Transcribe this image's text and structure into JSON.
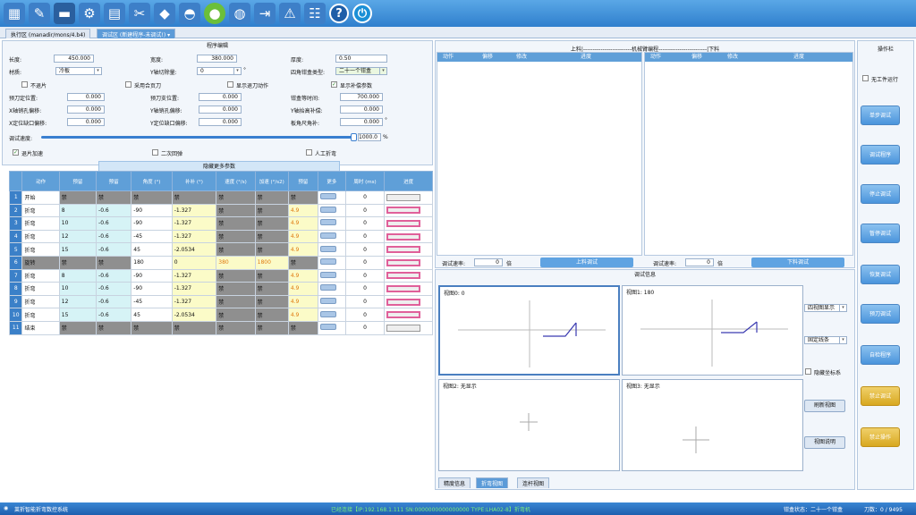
{
  "toolbar": {
    "icons": [
      "edit-window-icon",
      "new-document-icon",
      "monitor-icon",
      "gear-icon",
      "toolbox-icon",
      "tools-icon",
      "box-icon",
      "dome-icon",
      "circle-check-icon",
      "globe-icon",
      "logout-icon",
      "warning-icon",
      "network-icon",
      "help-icon",
      "power-icon"
    ],
    "help": "?",
    "power": "⏻"
  },
  "tabs": [
    {
      "label": "执行区 (manadir/mons/4.b4)"
    },
    {
      "label": "调试区 (新建程序-未调试!)  ▾"
    }
  ],
  "program_edit": {
    "title": "程序编辑",
    "row1": {
      "len_label": "长度:",
      "len": "450.000",
      "width_label": "宽度:",
      "width": "380.000",
      "thick_label": "厚度:",
      "thick": "0.50",
      "thick_unit": "▾"
    },
    "row2": {
      "mat_label": "材质:",
      "mat": "冷板",
      "y_label": "Y轴切除量:",
      "y": "0",
      "y_unit": "°",
      "corner_label": "四角钳盒类型:",
      "corner": "二十一个钳盒"
    },
    "row3": {
      "a": "不退片",
      "b": "采用合页刀",
      "c": "显示退刀动作",
      "d": "显示补偿参数"
    },
    "row4": {
      "l1": "预刀定位置:",
      "v1": "0.000",
      "l2": "预刀支位置:",
      "v2": "0.000",
      "l3": "钳盒等时间:",
      "v3": "700.000"
    },
    "row5": {
      "l1": "X轴销孔偏移:",
      "v1": "0.000",
      "l2": "Y轴销孔偏移:",
      "v2": "0.000",
      "l3": "Y轴抬高补偿:",
      "v3": "0.000"
    },
    "row6": {
      "l1": "X定位缺口偏移:",
      "v1": "0.000",
      "l2": "Y定位缺口偏移:",
      "v2": "0.000",
      "l3": "板角尺角补:",
      "v3": "0.000",
      "u3": "°"
    },
    "speed_label": "调试速度:",
    "speed_value": "1000.0",
    "speed_unit": "%",
    "check1": "退片加速",
    "check2": "二次回弹",
    "check3": "人工折弯"
  },
  "table": {
    "title": "隐藏更多参数",
    "headers": [
      "动作",
      "预留",
      "预留",
      "角度\n(°)",
      "补补\n(°)",
      "速度\n(°/s)",
      "加速\n(°/s2)",
      "预留",
      "更多",
      "周时\n(ms)",
      "进度"
    ],
    "rows": [
      {
        "n": "1",
        "act": "开始",
        "c1": "禁",
        "c2": "禁",
        "ang": "禁",
        "comp": "禁",
        "spd": "禁",
        "acc": "禁",
        "r": "禁",
        "t": "0",
        "type": "first"
      },
      {
        "n": "2",
        "act": "折弯",
        "c1": "8",
        "c2": "-0.6",
        "ang": "-90",
        "comp": "-1.327",
        "spd": "禁",
        "acc": "禁",
        "r": "4.9",
        "t": "0"
      },
      {
        "n": "3",
        "act": "折弯",
        "c1": "10",
        "c2": "-0.6",
        "ang": "-90",
        "comp": "-1.327",
        "spd": "禁",
        "acc": "禁",
        "r": "4.9",
        "t": "0"
      },
      {
        "n": "4",
        "act": "折弯",
        "c1": "12",
        "c2": "-0.6",
        "ang": "-45",
        "comp": "-1.327",
        "spd": "禁",
        "acc": "禁",
        "r": "4.9",
        "t": "0"
      },
      {
        "n": "5",
        "act": "折弯",
        "c1": "15",
        "c2": "-0.6",
        "ang": "45",
        "comp": "-2.0534",
        "spd": "禁",
        "acc": "禁",
        "r": "4.9",
        "t": "0"
      },
      {
        "n": "6",
        "act": "旋转",
        "c1": "禁",
        "c2": "禁",
        "ang": "180",
        "comp": "0",
        "spd": "380",
        "acc": "1800",
        "r": "禁",
        "t": "0",
        "type": "rotate"
      },
      {
        "n": "7",
        "act": "折弯",
        "c1": "8",
        "c2": "-0.6",
        "ang": "-90",
        "comp": "-1.327",
        "spd": "禁",
        "acc": "禁",
        "r": "4.9",
        "t": "0"
      },
      {
        "n": "8",
        "act": "折弯",
        "c1": "10",
        "c2": "-0.6",
        "ang": "-90",
        "comp": "-1.327",
        "spd": "禁",
        "acc": "禁",
        "r": "4.9",
        "t": "0"
      },
      {
        "n": "9",
        "act": "折弯",
        "c1": "12",
        "c2": "-0.6",
        "ang": "-45",
        "comp": "-1.327",
        "spd": "禁",
        "acc": "禁",
        "r": "4.9",
        "t": "0"
      },
      {
        "n": "10",
        "act": "折弯",
        "c1": "15",
        "c2": "-0.6",
        "ang": "45",
        "comp": "-2.0534",
        "spd": "禁",
        "acc": "禁",
        "r": "4.9",
        "t": "0"
      },
      {
        "n": "11",
        "act": "结束",
        "c1": "禁",
        "c2": "禁",
        "ang": "禁",
        "comp": "禁",
        "spd": "禁",
        "acc": "禁",
        "r": "禁",
        "t": "0",
        "type": "first"
      }
    ]
  },
  "robot": {
    "title": "上料|-------------------------机械臂编程-------------------------|下料",
    "left_headers": [
      "动作",
      "偏移",
      "修改",
      "进度"
    ],
    "right_headers": [
      "动作",
      "偏移",
      "修改",
      "进度"
    ],
    "load_rate_label": "调试速率:",
    "load_rate": "0",
    "load_unit": "倍",
    "load_btn": "上料调试",
    "unload_rate_label": "调试速率:",
    "unload_rate": "0",
    "unload_unit": "倍",
    "unload_btn": "下料调试"
  },
  "debug": {
    "title": "调试信息",
    "view0": "视图0: 0",
    "view1": "视图1: 180",
    "view2": "视图2: 无显示",
    "view3": "视图3: 无显示",
    "view_mode": "四视图显示",
    "line_mode": "固定线条",
    "hide_coords": "隐藏坐标系",
    "refresh": "刷新视图",
    "explain": "视图说明",
    "tabs": [
      "精度信息",
      "折弯视图",
      "连杆视图"
    ]
  },
  "side": {
    "title": "操作栏",
    "no_run": "无工件运行",
    "buttons": [
      "单步调试",
      "调试程序",
      "停止调试",
      "暂停调试",
      "恢复调试",
      "预刀调试",
      "自检程序",
      "禁止调试",
      "禁止操作"
    ]
  },
  "status": {
    "app": "莱折智能折弯数控系统",
    "conn": "已经连接【IP:192.168.1.111  SN:0000000000000000  TYPE:LHA02-8】折弯机",
    "box": "钳盒状态：二十一个钳盒",
    "count": "刀数：0 / 9495"
  }
}
